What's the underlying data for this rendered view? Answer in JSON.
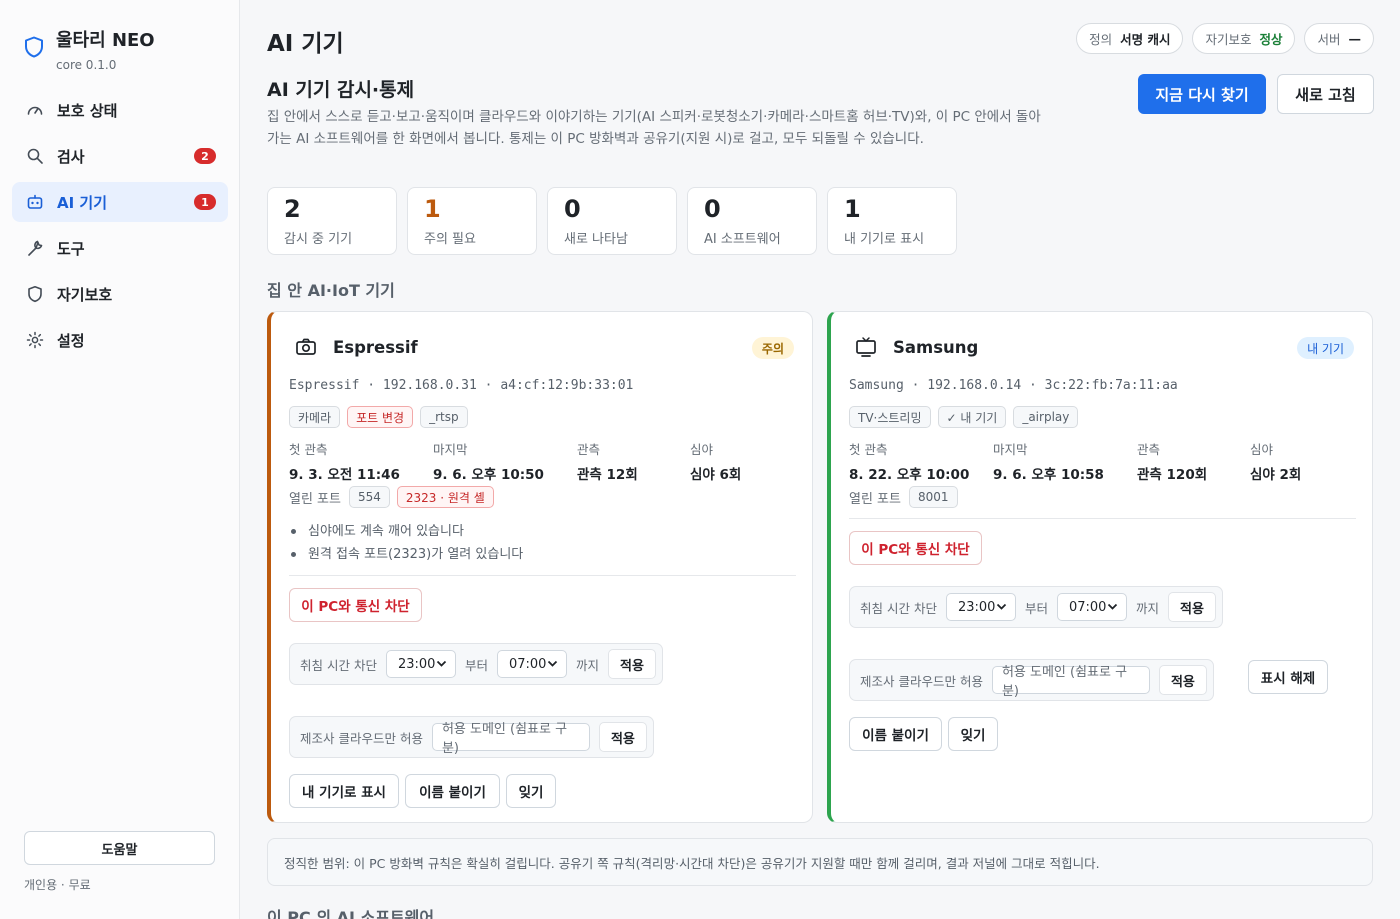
{
  "brand": {
    "name": "울타리 NEO",
    "version": "core 0.1.0"
  },
  "nav": [
    {
      "label": "보호 상태",
      "icon": "gauge-icon",
      "badge": ""
    },
    {
      "label": "검사",
      "icon": "search-icon",
      "badge": "2"
    },
    {
      "label": "AI 기기",
      "icon": "robot-icon",
      "badge": "1"
    },
    {
      "label": "도구",
      "icon": "wrench-icon",
      "badge": ""
    },
    {
      "label": "자기보호",
      "icon": "shield-icon",
      "badge": ""
    },
    {
      "label": "설정",
      "icon": "gear-icon",
      "badge": ""
    }
  ],
  "sidebar_footer": {
    "help": "도움말",
    "license": "개인용 · 무료"
  },
  "header": {
    "title": "AI 기기",
    "pills": [
      {
        "key": "정의",
        "value": "서명 캐시"
      },
      {
        "key": "자기보호",
        "value": "정상"
      },
      {
        "key": "서버",
        "value": "—"
      }
    ]
  },
  "section": {
    "title": "AI 기기 감시·통제",
    "desc": "집 안에서 스스로 듣고·보고·움직이며 클라우드와 이야기하는 기기(AI 스피커·로봇청소기·카메라·스마트홈 허브·TV)와, 이 PC 안에서 돌아가는 AI 소프트웨어를 한 화면에서 봅니다. 통제는 이 PC 방화벽과 공유기(지원 시)로 걸고, 모두 되돌릴 수 있습니다.",
    "rescan": "지금 다시 찾기",
    "refresh": "새로 고침"
  },
  "stats": [
    {
      "value": "2",
      "label": "감시 중 기기"
    },
    {
      "value": "1",
      "label": "주의 필요"
    },
    {
      "value": "0",
      "label": "새로 나타남"
    },
    {
      "value": "0",
      "label": "AI 소프트웨어"
    },
    {
      "value": "1",
      "label": "내 기기로 표시"
    }
  ],
  "home_group_title": "집 안 AI·IoT 기기",
  "devices": [
    {
      "name": "Espressif",
      "status_tag": "주의",
      "meta": "Espressif · 192.168.0.31 · a4:cf:12:9b:33:01",
      "chips": [
        "카메라",
        "포트 변경",
        "_rtsp"
      ],
      "obs": [
        {
          "k": "첫 관측",
          "v": "9. 3. 오전 11:46"
        },
        {
          "k": "마지막",
          "v": "9. 6. 오후 10:50"
        },
        {
          "k": "관측",
          "v": "관측 12회"
        },
        {
          "k": "심야",
          "v": "심야 6회"
        }
      ],
      "ports_label": "열린 포트",
      "ports": [
        "554",
        "2323 · 원격 셸"
      ],
      "notes": [
        "심야에도 계속 깨어 있습니다",
        "원격 접속 포트(2323)가 열려 있습니다"
      ],
      "block_btn": "이 PC와 통신 차단",
      "sleep_label": "취침 시간 차단",
      "sleep_from": "23:00",
      "from_word": "부터",
      "sleep_to": "07:00",
      "to_word": "까지",
      "apply": "적용",
      "cloud_label": "제조사 클라우드만 허용",
      "domain_placeholder": "허용 도메인 (쉼표로 구분)",
      "actions": [
        "내 기기로 표시",
        "이름 붙이기",
        "잊기"
      ]
    },
    {
      "name": "Samsung",
      "status_tag": "내 기기",
      "meta": "Samsung · 192.168.0.14 · 3c:22:fb:7a:11:aa",
      "chips": [
        "TV·스트리밍",
        "✓ 내 기기",
        "_airplay"
      ],
      "obs": [
        {
          "k": "첫 관측",
          "v": "8. 22. 오후 10:00"
        },
        {
          "k": "마지막",
          "v": "9. 6. 오후 10:58"
        },
        {
          "k": "관측",
          "v": "관측 120회"
        },
        {
          "k": "심야",
          "v": "심야 2회"
        }
      ],
      "ports_label": "열린 포트",
      "ports": [
        "8001"
      ],
      "block_btn": "이 PC와 통신 차단",
      "sleep_label": "취침 시간 차단",
      "sleep_from": "23:00",
      "from_word": "부터",
      "sleep_to": "07:00",
      "to_word": "까지",
      "apply": "적용",
      "cloud_label": "제조사 클라우드만 허용",
      "domain_placeholder": "허용 도메인 (쉼표로 구분)",
      "unmark": "표시 해제",
      "actions": [
        "이름 붙이기",
        "잊기"
      ]
    }
  ],
  "honest_note": "정직한 범위: 이 PC 방화벽 규칙은 확실히 걸립니다. 공유기 쪽 규칙(격리망·시간대 차단)은 공유기가 지원할 때만 함께 걸리며, 결과 저널에 그대로 적힙니다.",
  "pc_group_title": "이 PC 의 AI 소프트웨어",
  "colors": {
    "accent": "#1f6feb",
    "warn": "#bc5a0e",
    "ok": "#2da44e",
    "danger": "#cf222e"
  }
}
